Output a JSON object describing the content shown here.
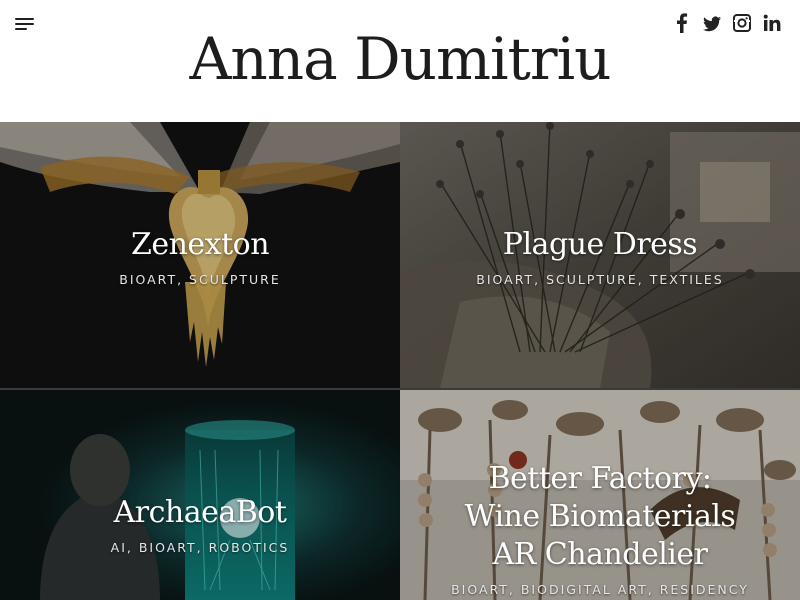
{
  "header": {
    "site_title": "Anna Dumitriu",
    "menu_icon": "hamburger-menu-icon",
    "social": [
      {
        "name": "facebook",
        "icon": "facebook-icon"
      },
      {
        "name": "twitter",
        "icon": "twitter-icon"
      },
      {
        "name": "instagram",
        "icon": "instagram-icon"
      },
      {
        "name": "linkedin",
        "icon": "linkedin-icon"
      }
    ]
  },
  "projects": [
    {
      "title": "Zenexton",
      "categories": "BIOART, SCULPTURE"
    },
    {
      "title": "Plague Dress",
      "categories": "BIOART, SCULPTURE, TEXTILES"
    },
    {
      "title": "ArchaeaBot",
      "categories": "AI, BIOART, ROBOTICS"
    },
    {
      "title": "Better Factory: Wine Biomaterials AR Chandelier",
      "categories": "BIOART, BIODIGITAL ART, RESIDENCY"
    }
  ],
  "colors": {
    "text": "#1d1d1d",
    "overlay_text": "#ffffff",
    "background": "#ffffff"
  }
}
